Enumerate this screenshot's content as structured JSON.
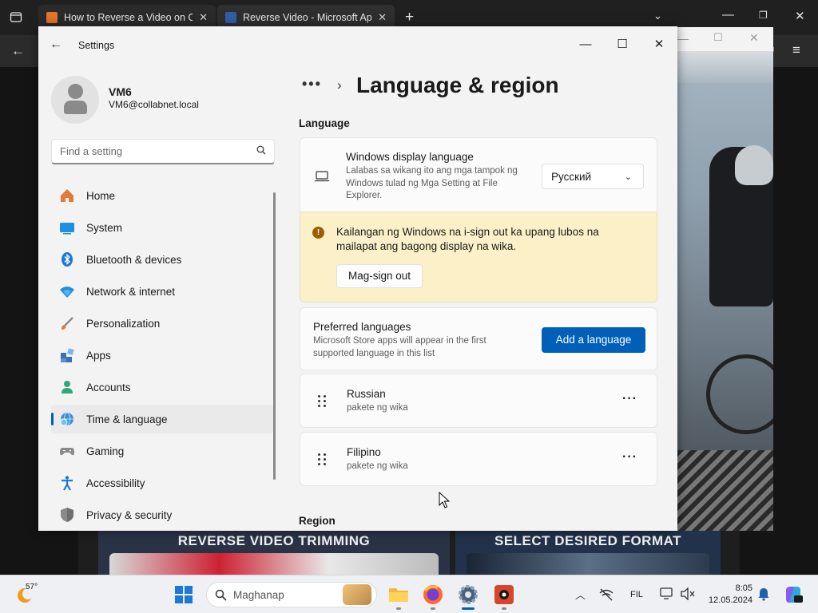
{
  "browser": {
    "tabs": [
      {
        "title": "How to Reverse a Video on CapCut",
        "close": "✕"
      },
      {
        "title": "Reverse Video - Microsoft Apps",
        "close": "✕"
      }
    ],
    "new_tab": "+"
  },
  "background_page": {
    "banners": [
      "REVERSE VIDEO TRIMMING",
      "SELECT DESIRED FORMAT"
    ]
  },
  "settings": {
    "app_title": "Settings",
    "user": {
      "name": "VM6",
      "email": "VM6@collabnet.local"
    },
    "search": {
      "placeholder": "Find a setting"
    },
    "nav": [
      {
        "label": "Home",
        "icon": "home-icon"
      },
      {
        "label": "System",
        "icon": "system-icon"
      },
      {
        "label": "Bluetooth & devices",
        "icon": "bluetooth-icon"
      },
      {
        "label": "Network & internet",
        "icon": "wifi-icon"
      },
      {
        "label": "Personalization",
        "icon": "brush-icon"
      },
      {
        "label": "Apps",
        "icon": "apps-icon"
      },
      {
        "label": "Accounts",
        "icon": "account-icon"
      },
      {
        "label": "Time & language",
        "icon": "globe-clock-icon",
        "active": true
      },
      {
        "label": "Gaming",
        "icon": "gamepad-icon"
      },
      {
        "label": "Accessibility",
        "icon": "accessibility-icon"
      },
      {
        "label": "Privacy & security",
        "icon": "shield-icon"
      }
    ],
    "breadcrumb": {
      "overflow": "•••",
      "chevron": "›"
    },
    "page_title": "Language & region",
    "language_section": "Language",
    "display_language": {
      "title": "Windows display language",
      "description": "Lalabas sa wikang ito ang mga tampok ng Windows tulad ng Mga Setting at File Explorer.",
      "selected": "Русский"
    },
    "warning": {
      "text": "Kailangan ng Windows na i-sign out ka upang lubos na mailapat ang bagong display na wika.",
      "button": "Mag-sign out"
    },
    "preferred": {
      "title": "Preferred languages",
      "description": "Microsoft Store apps will appear in the first supported language in this list",
      "button": "Add a language"
    },
    "languages": [
      {
        "name": "Russian",
        "sub": "pakete ng wika"
      },
      {
        "name": "Filipino",
        "sub": "pakete ng wika"
      }
    ],
    "region_section": "Region"
  },
  "taskbar": {
    "temperature": "57°",
    "search_label": "Maghanap",
    "input_lang": "FIL",
    "time": "8:05",
    "date": "12.05.2024"
  },
  "colors": {
    "accent": "#005fb8",
    "warning_bg": "#fcf0c9",
    "warning_icon": "#9d5d00"
  }
}
